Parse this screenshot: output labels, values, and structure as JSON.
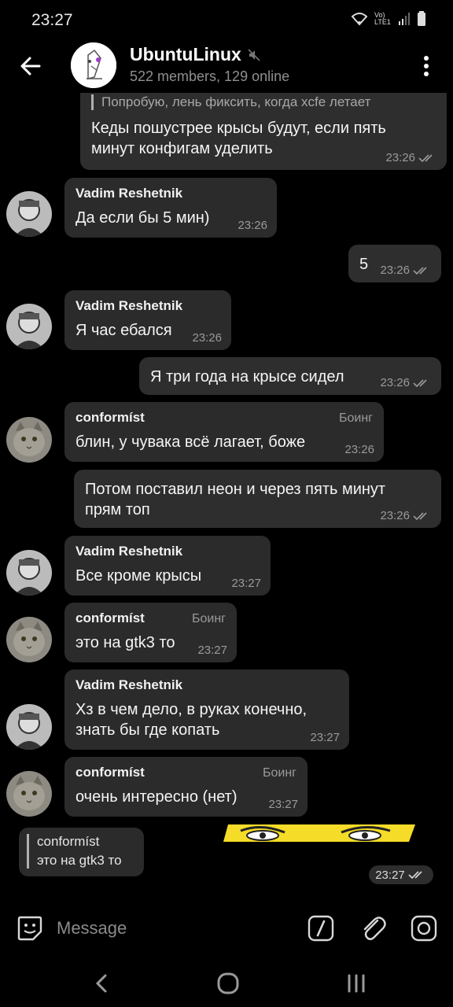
{
  "status": {
    "time": "23:27",
    "network": "Vo) LTE1"
  },
  "header": {
    "title": "UbuntuLinux",
    "subtitle": "522 members, 129 online"
  },
  "messages": [
    {
      "id": "m1",
      "direction": "out",
      "reply_preview": "Попробую, лень фиксить, когда xcfe летает",
      "text_lines": [
        "Кеды пошустрее крысы будут, если пять",
        "минут конфигам уделить"
      ],
      "time": "23:26",
      "read": true
    },
    {
      "id": "m2",
      "direction": "in",
      "sender": "Vadim Reshetnik",
      "text_lines": [
        "Да если бы 5 мин)"
      ],
      "time": "23:26"
    },
    {
      "id": "m3",
      "direction": "out",
      "text_lines": [
        "5"
      ],
      "time": "23:26",
      "read": true
    },
    {
      "id": "m4",
      "direction": "in",
      "sender": "Vadim Reshetnik",
      "text_lines": [
        "Я час ебался"
      ],
      "time": "23:26"
    },
    {
      "id": "m5",
      "direction": "out",
      "text_lines": [
        "Я три года на крысе сидел"
      ],
      "time": "23:26",
      "read": true
    },
    {
      "id": "m6",
      "direction": "in",
      "sender": "conformíst",
      "rank": "Боинг",
      "text_lines": [
        "блин, у чувака всё лагает, боже"
      ],
      "time": "23:26"
    },
    {
      "id": "m7",
      "direction": "out",
      "text_lines": [
        "Потом поставил неон и через пять минут",
        "прям топ"
      ],
      "time": "23:26",
      "read": true
    },
    {
      "id": "m8",
      "direction": "in",
      "sender": "Vadim Reshetnik",
      "text_lines": [
        "Все кроме крысы"
      ],
      "time": "23:27"
    },
    {
      "id": "m9",
      "direction": "in",
      "sender": "conformíst",
      "rank": "Боинг",
      "text_lines": [
        "это на gtk3 то"
      ],
      "time": "23:27"
    },
    {
      "id": "m10",
      "direction": "in",
      "sender": "Vadim Reshetnik",
      "text_lines": [
        "Хз в чем дело, в руках конечно,",
        "знать бы где копать"
      ],
      "time": "23:27"
    },
    {
      "id": "m11",
      "direction": "in",
      "sender": "conformíst",
      "rank": "Боинг",
      "text_lines": [
        "очень интересно (нет)"
      ],
      "time": "23:27"
    },
    {
      "id": "m12",
      "direction": "out",
      "reply_sender": "conformíst",
      "reply_text": "это на gtk3 то",
      "time": "23:27",
      "read": true,
      "sticker": "yellow-eyes-sticker"
    }
  ],
  "input": {
    "placeholder": "Message"
  },
  "colors": {
    "bubble": "#2b2b2b",
    "background": "#000000",
    "sticker_yellow": "#f4dc28"
  }
}
